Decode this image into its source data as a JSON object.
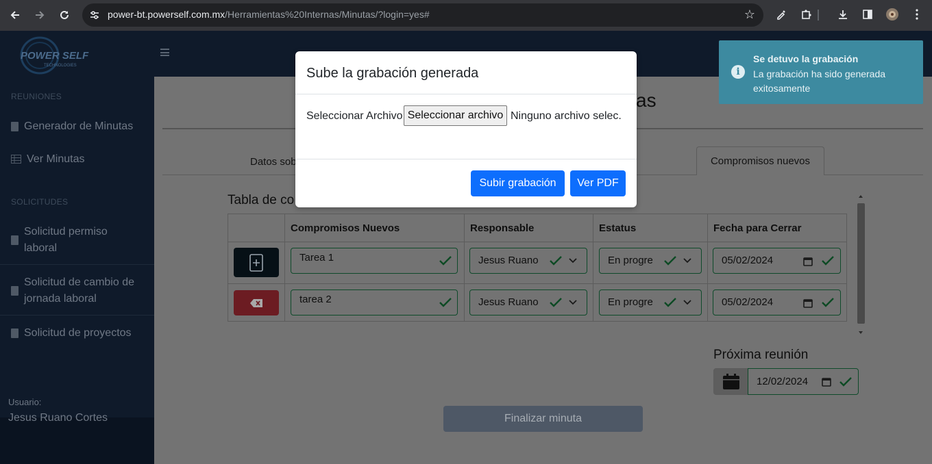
{
  "browser": {
    "url_host": "power-bt.powerself.com.mx",
    "url_path": "/Herramientas%20Internas/Minutas/?login=yes#",
    "back_icon": "arrow-left-icon",
    "forward_icon": "arrow-right-icon",
    "reload_icon": "reload-icon"
  },
  "sidebar": {
    "logo_text": "POWER SELF",
    "logo_sub": "TECHNOLOGIES",
    "section_reuniones": "REUNIONES",
    "item_generador": "Generador de Minutas",
    "item_ver": "Ver Minutas",
    "section_solicitudes": "SOLICITUDES",
    "item_permiso_1": "Solicitud permiso",
    "item_permiso_2": "laboral",
    "item_cambio_1": "Solicitud de cambio de",
    "item_cambio_2": "jornada laboral",
    "item_proyectos": "Solicitud de proyectos",
    "user_label": "Usuario:",
    "user_name": "Jesus Ruano Cortes"
  },
  "page": {
    "title_fragment": "as",
    "tab_left_fragment": "Datos sob",
    "tab_active": "Compromisos nuevos",
    "table_title_fragment": "Tabla de co"
  },
  "table": {
    "headers": [
      "Compromisos Nuevos",
      "Responsable",
      "Estatus",
      "Fecha para Cerrar"
    ],
    "rows": [
      {
        "tarea": "Tarea 1",
        "responsable": "Jesus Ruano",
        "estatus": "En progre",
        "fecha": "05/02/2024"
      },
      {
        "tarea": "tarea 2",
        "responsable": "Jesus Ruano",
        "estatus": "En progre",
        "fecha": "05/02/2024"
      }
    ]
  },
  "next_meeting": {
    "title": "Próxima reunión",
    "date": "12/02/2024"
  },
  "finalizar_label": "Finalizar minuta",
  "modal": {
    "title": "Sube la grabación generada",
    "file_label": "Seleccionar Archivo",
    "file_button": "Seleccionar archivo",
    "file_none": "Ninguno archivo selec.",
    "upload_button": "Subir grabación",
    "pdf_button": "Ver PDF"
  },
  "toast": {
    "title": "Se detuvo la grabación",
    "message": "La grabación ha sido generada exitosamente"
  },
  "colors": {
    "primary": "#0d6efd",
    "toast_bg": "#3d8aa0",
    "success": "#198754"
  }
}
